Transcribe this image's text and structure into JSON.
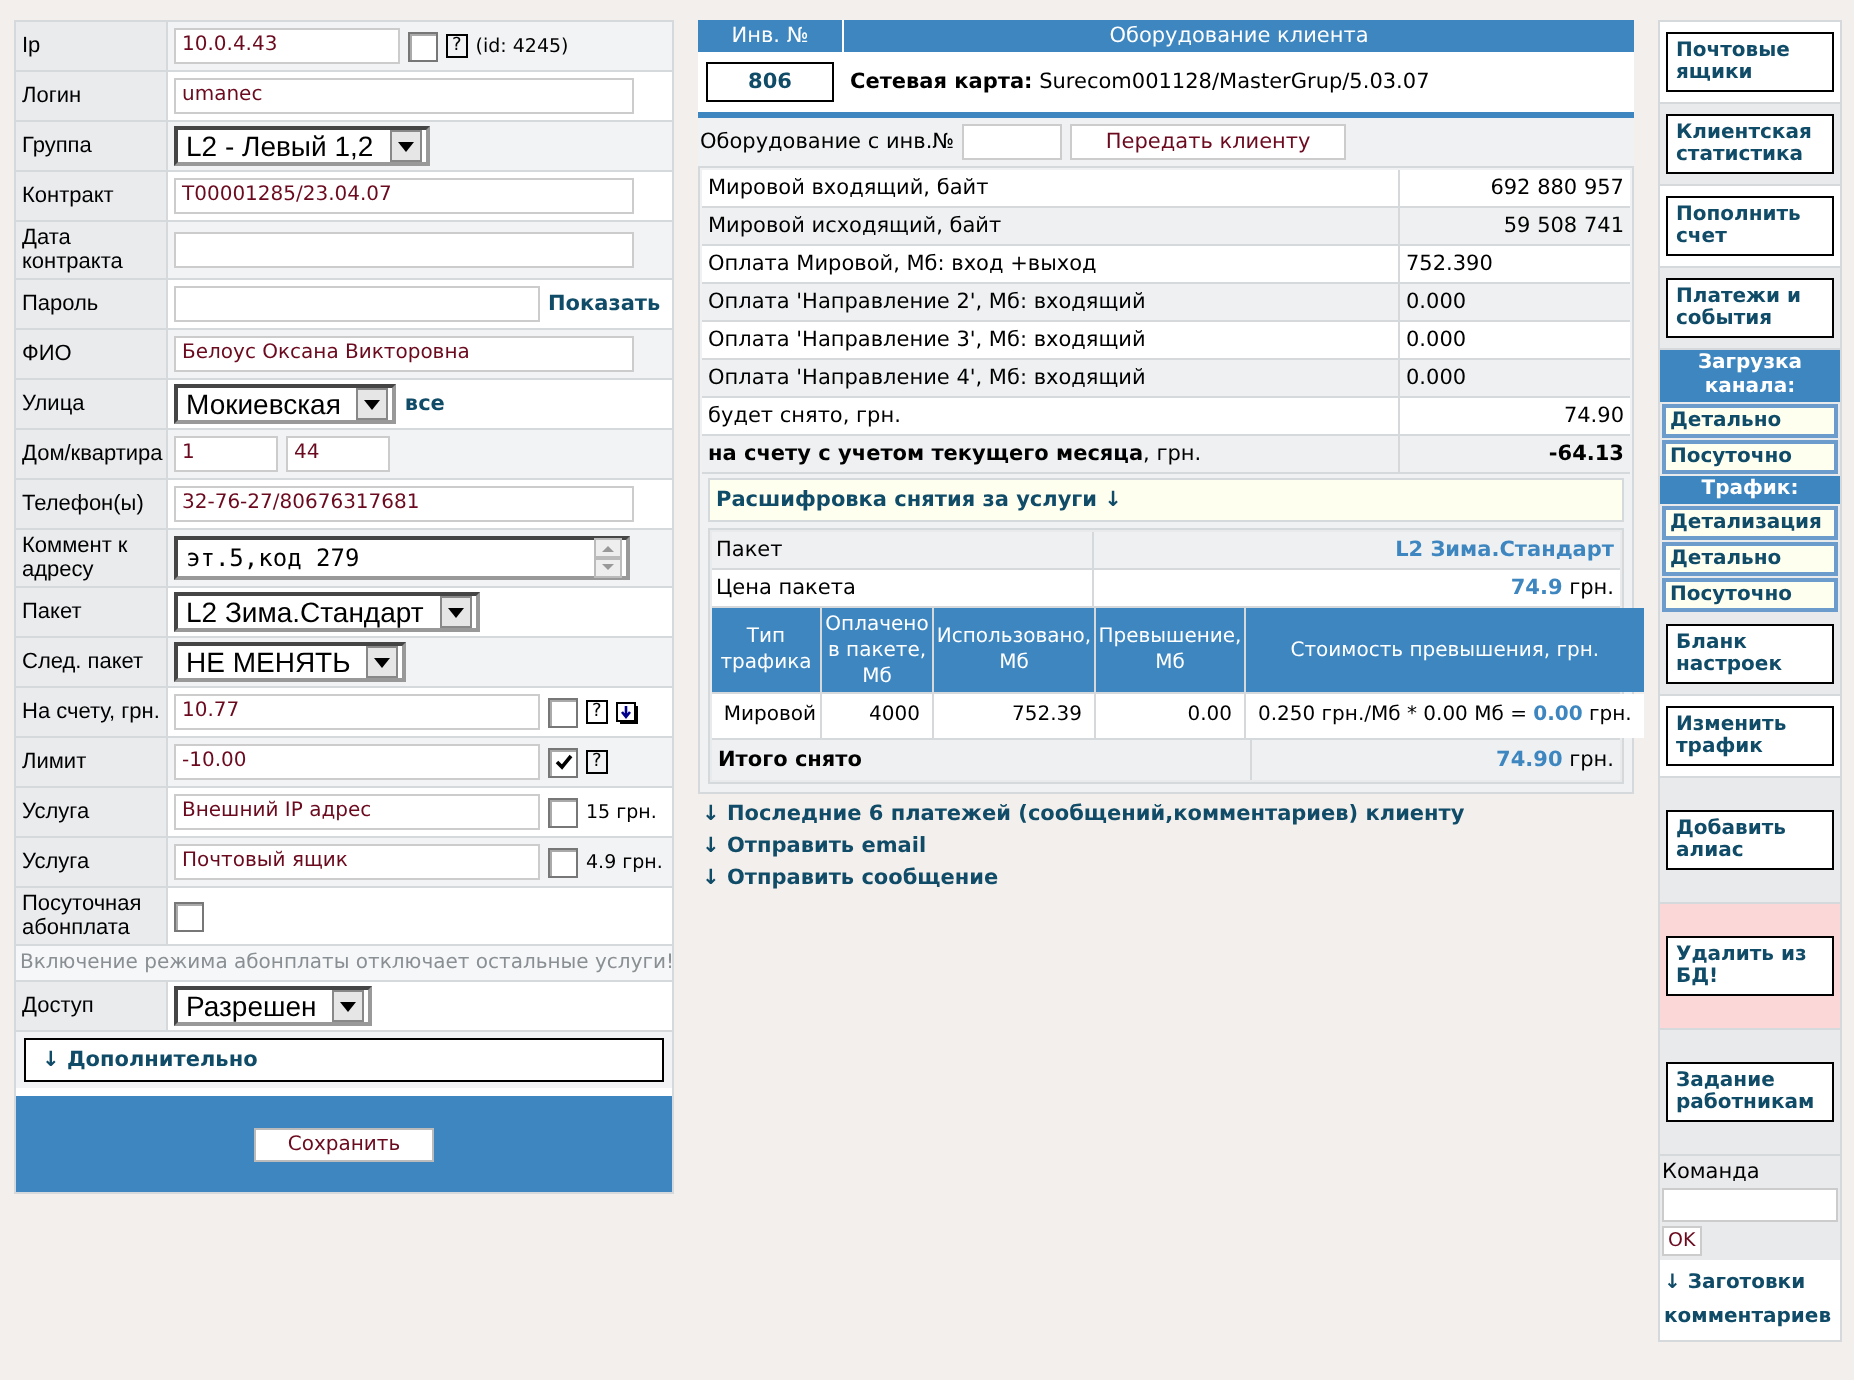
{
  "form": {
    "fields": [
      {
        "label": "Ip",
        "kind": "input",
        "value": "10.0.4.43",
        "checked": false,
        "help": "?",
        "note": "(id: 4245)"
      },
      {
        "label": "Логин",
        "kind": "input",
        "value": "umanec"
      },
      {
        "label": "Группа",
        "kind": "select",
        "value": "L2 - Левый 1,2"
      },
      {
        "label": "Контракт",
        "kind": "input",
        "value": "T00001285/23.04.07"
      },
      {
        "label": "Дата контракта",
        "kind": "input"
      },
      {
        "label": "Пароль",
        "kind": "input",
        "link": "Показать"
      },
      {
        "label": "ФИО",
        "kind": "input",
        "value": "Белоус Оксана Викторовна"
      },
      {
        "label": "Улица",
        "kind": "select",
        "value": "Мокиевская",
        "link": "все"
      },
      {
        "label": "Дом/квартира",
        "kind": "pair",
        "values": [
          "1",
          "44"
        ]
      },
      {
        "label": "Телефон(ы)",
        "kind": "input",
        "value": "32-76-27/80676317681"
      },
      {
        "label": "Коммент к адресу",
        "kind": "textarea",
        "value": "эт.5,код 279"
      },
      {
        "label": "Пакет",
        "kind": "select",
        "value": "L2 Зима.Стандарт"
      },
      {
        "label": "След. пакет",
        "kind": "select",
        "value": "НЕ МЕНЯТЬ"
      },
      {
        "label": "На счету, грн.",
        "kind": "input",
        "value": "10.77",
        "checked": false,
        "help": "?",
        "download": true
      },
      {
        "label": "Лимит",
        "kind": "input",
        "value": "-10.00",
        "checked": true,
        "help": "?"
      },
      {
        "label": "Услуга",
        "kind": "input",
        "value": "Внешний IP адрес",
        "checked": false,
        "note": "15 грн."
      },
      {
        "label": "Услуга",
        "kind": "input",
        "value": "Почтовый ящик",
        "checked": false,
        "note": "4.9 грн."
      },
      {
        "label": "Посуточная абонплата",
        "kind": "checkbox",
        "checked": false
      },
      {
        "kind": "notice",
        "text": "Включение режима абонплаты отключает остальные услуги!"
      },
      {
        "label": "Доступ",
        "kind": "select",
        "value": "Разрешен"
      }
    ],
    "more_link": "↓ Дополнительно",
    "save_button": "Сохранить"
  },
  "equipment": {
    "columns": [
      "Инв. №",
      "Оборудование клиента"
    ],
    "inv": "806",
    "description": "**Сетевая карта:** Surecom001128/MasterGrup/5.03.07"
  },
  "transfer": {
    "label": "Оборудование с инв.№",
    "button": "Передать клиенту"
  },
  "stats": [
    {
      "label": "Мировой входящий, байт",
      "value": "692 880 957",
      "kind": "count"
    },
    {
      "label": "Мировой исходящий, байт",
      "value": "59 508 741",
      "kind": "count"
    },
    {
      "label": "Оплата Мировой, Мб: вход +выход",
      "value": "752.390",
      "kind": "traffic"
    },
    {
      "label": "Оплата 'Направление 2', Мб: входящий",
      "value": "0.000",
      "kind": "traffic"
    },
    {
      "label": "Оплата 'Направление 3', Мб: входящий",
      "value": "0.000",
      "kind": "traffic"
    },
    {
      "label": "Оплата 'Направление 4', Мб: входящий",
      "value": "0.000",
      "kind": "traffic"
    },
    {
      "label": "будет снято, грн.",
      "value": "74.90",
      "kind": "count"
    },
    {
      "label": "**на счету с учетом текущего месяца**, грн.",
      "value": "-64.13",
      "kind": "balance"
    }
  ],
  "breakdown_toggle": "Расшифровка снятия за услуги ↓",
  "package": {
    "info": [
      {
        "label": "Пакет",
        "value": "**L2 Зима.Стандарт**"
      },
      {
        "label": "Цена пакета",
        "value": "**74.9** грн."
      }
    ],
    "columns": [
      "Тип трафика",
      "Оплачено в пакете, Мб",
      "Использовано, Мб",
      "Превышение, Мб",
      "Стоимость превышения, грн."
    ],
    "rows": [
      [
        "Мировой",
        "4000",
        "752.39",
        "0.00",
        "0.250 грн./Мб * 0.00 Мб = **0.00** грн."
      ]
    ],
    "total": {
      "label": "Итого снято",
      "value": "**74.90** грн."
    }
  },
  "links": [
    "↓ Последние 6 платежей (сообщений,комментариев) клиенту",
    "↓ Отправить email",
    "↓ Отправить сообщение"
  ],
  "actions": [
    {
      "kind": "button",
      "label": "Почтовые ящики"
    },
    {
      "kind": "button",
      "label": "Клиентская статистика"
    },
    {
      "kind": "button",
      "label": "Пополнить счет"
    },
    {
      "kind": "button",
      "label": "Платежи и события"
    },
    {
      "kind": "header",
      "label": "Загрузка канала:"
    },
    {
      "kind": "link",
      "label": "Детально"
    },
    {
      "kind": "link",
      "label": "Посуточно"
    },
    {
      "kind": "header",
      "label": "Трафик:"
    },
    {
      "kind": "link",
      "label": "Детализация"
    },
    {
      "kind": "link",
      "label": "Детально"
    },
    {
      "kind": "link",
      "label": "Посуточно"
    },
    {
      "kind": "button",
      "label": "Бланк настроек"
    },
    {
      "kind": "button",
      "label": "Изменить трафик"
    },
    {
      "kind": "button",
      "label": "Добавить алиас"
    },
    {
      "kind": "danger",
      "label": "Удалить из БД!"
    },
    {
      "kind": "button",
      "label": "Задание работникам"
    }
  ],
  "command": {
    "label": "Команда",
    "button": "OK"
  },
  "templates_link": "↓ Заготовки комментариев"
}
